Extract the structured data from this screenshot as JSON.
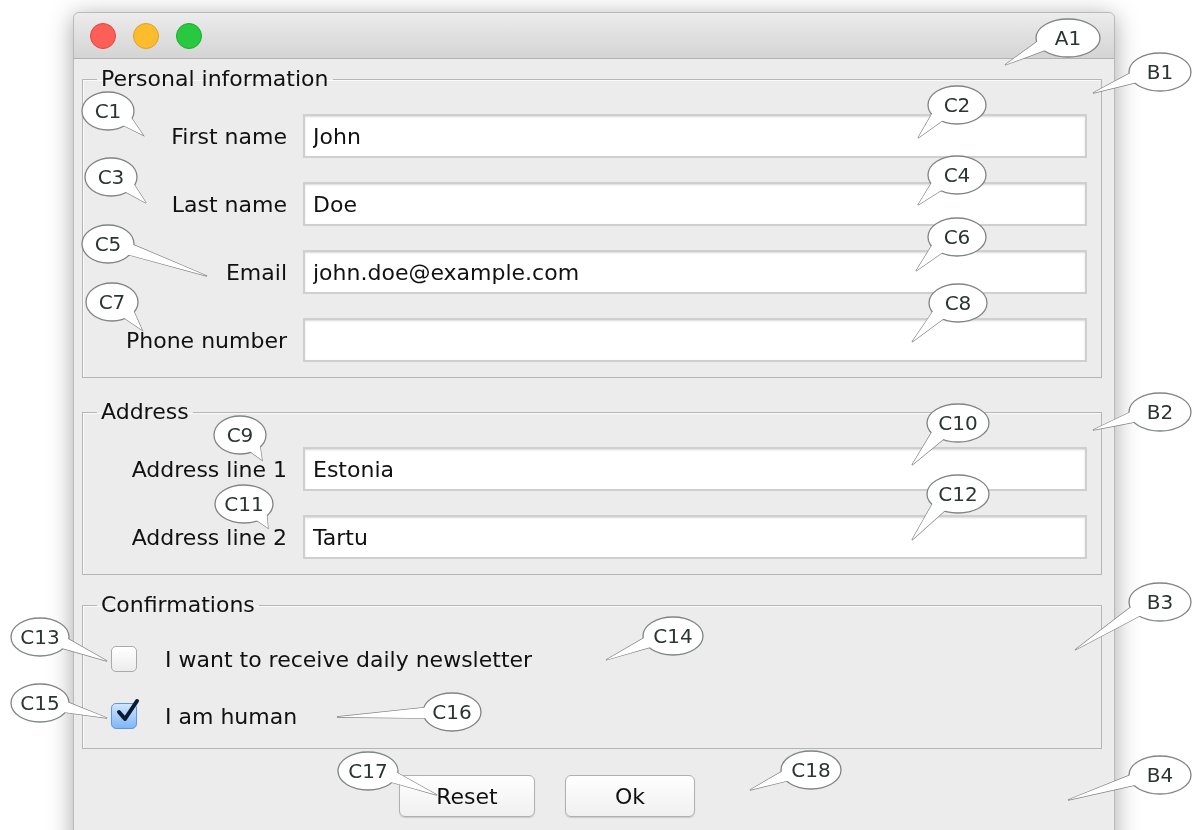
{
  "groups": [
    {
      "title": "Personal information",
      "kind": "fields",
      "fields": [
        {
          "label": "First name",
          "value": "John"
        },
        {
          "label": "Last name",
          "value": "Doe"
        },
        {
          "label": "Email",
          "value": "john.doe@example.com"
        },
        {
          "label": "Phone number"
        }
      ]
    },
    {
      "title": "Address",
      "kind": "fields",
      "fields": [
        {
          "label": "Address line 1",
          "value": "Estonia"
        },
        {
          "label": "Address line 2",
          "value": "Tartu"
        }
      ]
    },
    {
      "title": "Confirmations",
      "kind": "checks",
      "checks": [
        {
          "label": "I want to receive daily newsletter",
          "checked": false
        },
        {
          "label": "I am human",
          "checked": true
        }
      ]
    }
  ],
  "buttons": [
    "Reset",
    "Ok"
  ],
  "callouts": [
    {
      "label": "A1"
    },
    {
      "label": "B1"
    },
    {
      "label": "C1"
    },
    {
      "label": "C2"
    },
    {
      "label": "C3"
    },
    {
      "label": "C4"
    },
    {
      "label": "C5"
    },
    {
      "label": "C6"
    },
    {
      "label": "C7"
    },
    {
      "label": "C8"
    },
    {
      "label": "B2"
    },
    {
      "label": "C9"
    },
    {
      "label": "C10"
    },
    {
      "label": "C11"
    },
    {
      "label": "C12"
    },
    {
      "label": "B3"
    },
    {
      "label": "C13"
    },
    {
      "label": "C14"
    },
    {
      "label": "C15"
    },
    {
      "label": "C16"
    },
    {
      "label": "C17"
    },
    {
      "label": "C18"
    },
    {
      "label": "B4"
    }
  ]
}
